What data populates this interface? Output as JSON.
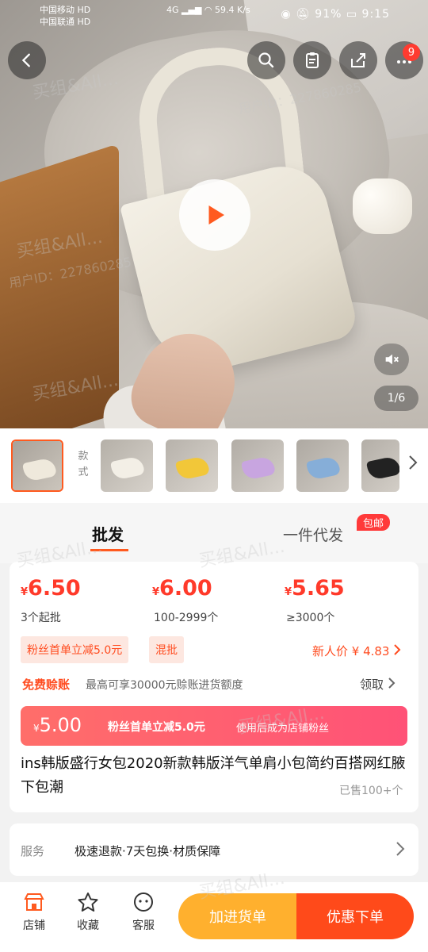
{
  "status_bar": {
    "carrier1": "中国移动 HD",
    "carrier2": "中国联通 HD",
    "network": "4G",
    "speed": "59.4 K/s",
    "battery": "91%",
    "time": "9:15"
  },
  "header": {
    "cart_badge": "9"
  },
  "media": {
    "pager": "1/6"
  },
  "thumbnails": {
    "label": "款式",
    "items": [
      {
        "color": "#efe9dc"
      },
      {
        "color": "#f3efe6"
      },
      {
        "color": "#f2c739"
      },
      {
        "color": "#c8a5e0"
      },
      {
        "color": "#86aed8"
      },
      {
        "color": "#222222"
      }
    ]
  },
  "tabs": {
    "wholesale": "批发",
    "dropship": "一件代发",
    "free_shipping_badge": "包邮"
  },
  "prices": [
    {
      "yen": "¥",
      "value": "6.50",
      "qty": "3个起批"
    },
    {
      "yen": "¥",
      "value": "6.00",
      "qty": "100-2999个"
    },
    {
      "yen": "¥",
      "value": "5.65",
      "qty": "≥3000个"
    }
  ],
  "tags": {
    "fans_discount": "粉丝首单立减5.0元",
    "mixed": "混批",
    "new_user_price": "新人价 ¥ 4.83"
  },
  "credit": {
    "label": "免费赊账",
    "desc": "最高可享30000元赊账进货额度",
    "action": "领取"
  },
  "banner": {
    "yen": "¥",
    "price": "5.00",
    "text1": "粉丝首单立减5.0元",
    "text2": "使用后成为店铺粉丝"
  },
  "product": {
    "title": "ins韩版盛行女包2020新款韩版洋气单肩小包简约百搭网红腋下包潮",
    "sold": "已售100+个"
  },
  "service": {
    "label": "服务",
    "value": "极速退款·7天包换·材质保障"
  },
  "bottom": {
    "shop": "店铺",
    "favorite": "收藏",
    "support": "客服",
    "add_stock": "加进货单",
    "buy": "优惠下单"
  },
  "watermark": {
    "brand": "买组&All...",
    "user": "用户ID：227860285"
  }
}
